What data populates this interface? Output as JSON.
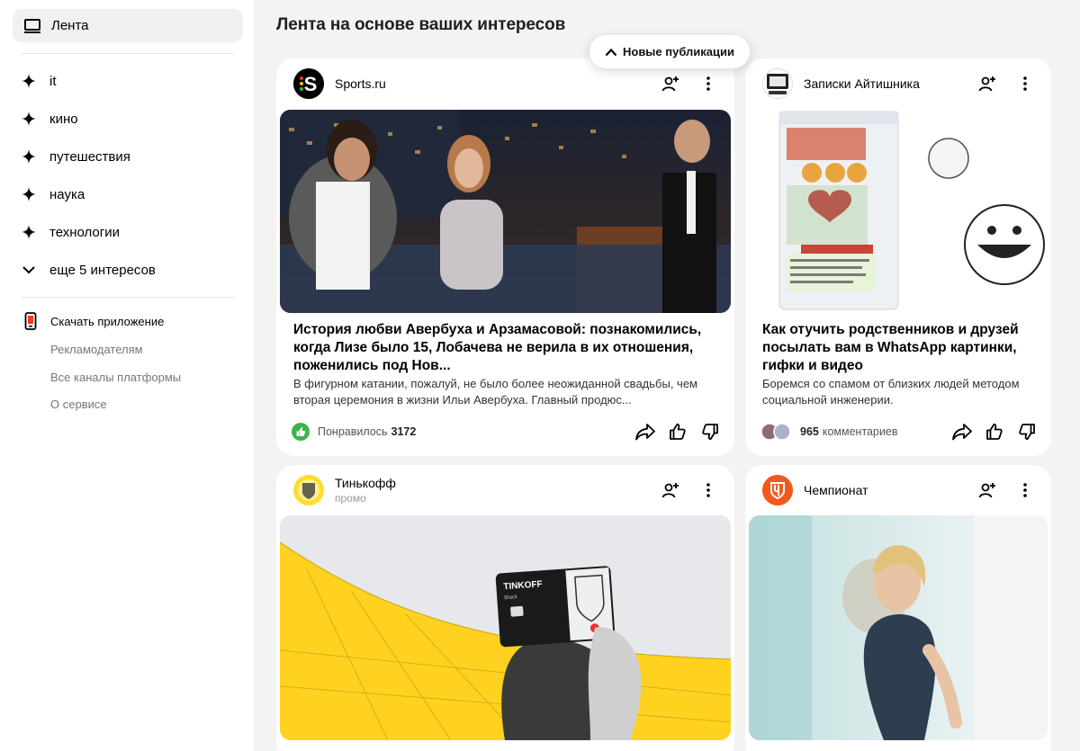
{
  "sidebar": {
    "active": {
      "label": "Лента",
      "icon": "monitor-icon"
    },
    "interests": [
      {
        "label": "it",
        "icon": "sparkle-icon"
      },
      {
        "label": "кино",
        "icon": "sparkle-icon"
      },
      {
        "label": "путешествия",
        "icon": "sparkle-icon"
      },
      {
        "label": "наука",
        "icon": "sparkle-icon"
      },
      {
        "label": "технологии",
        "icon": "sparkle-icon"
      }
    ],
    "more": {
      "label": "еще 5 интересов",
      "icon": "chevron-down-icon"
    },
    "download": {
      "label": "Скачать приложение",
      "icon": "phone-icon"
    },
    "links": [
      "Рекламодателям",
      "Все каналы платформы",
      "О сервисе"
    ]
  },
  "main": {
    "title": "Лента на основе ваших интересов",
    "new_posts_label": "Новые публикации"
  },
  "cards": [
    {
      "source": "Sports.ru",
      "title": "История любви Авербуха и Арзамасовой: познакомились, когда Лизе было 15, Лобачева не верила в их отношения, поженились под Нов...",
      "snippet": "В фигурном катании, пожалуй, не было более неожиданной свадьбы, чем вторая церемония в жизни Ильи Авербуха. Главный продюс...",
      "stat_label": "Понравилось",
      "stat_value": "3172"
    },
    {
      "source": "Записки Айтишника",
      "title": "Как отучить родственников и друзей посылать вам в WhatsApp картинки, гифки и видео",
      "snippet": "Боремся со спамом от близких людей методом социальной инженерии.",
      "stat_value": "965",
      "stat_label": "комментариев"
    },
    {
      "source": "Тинькофф",
      "sub": "промо",
      "card_brand": "TINKOFF",
      "card_tier": "Black"
    },
    {
      "source": "Чемпионат"
    }
  ],
  "colors": {
    "accent_green": "#3bb54a",
    "championat_orange": "#f25a1d",
    "tinkoff_yellow": "#ffdd2d"
  }
}
